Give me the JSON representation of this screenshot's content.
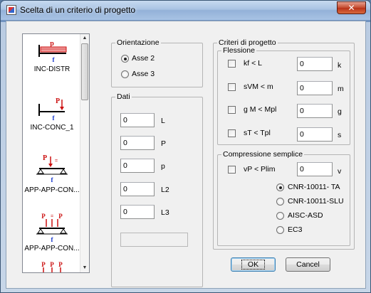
{
  "window": {
    "title": "Scelta di un criterio di progetto",
    "close_glyph": "✕"
  },
  "schemes": [
    {
      "label": "INC-DISTR",
      "icon": "cantilever-distributed-load-icon"
    },
    {
      "label": "INC-CONC_1",
      "icon": "cantilever-concentrated-load-icon"
    },
    {
      "label": "APP-APP-CON...",
      "icon": "simply-supported-concentrated-load-icon"
    },
    {
      "label": "APP-APP-CON...",
      "icon": "simply-supported-multiple-loads-icon"
    },
    {
      "label": "",
      "icon": "simply-supported-three-loads-icon"
    }
  ],
  "scheme_glyphs": {
    "p_upper": "P",
    "p_lower": "p",
    "f": "f",
    "eq": "="
  },
  "orientazione": {
    "label": "Orientazione",
    "options": [
      {
        "label": "Asse 2",
        "checked": true
      },
      {
        "label": "Asse 3",
        "checked": false
      }
    ]
  },
  "dati": {
    "label": "Dati",
    "fields": [
      {
        "value": "0",
        "unit": "L"
      },
      {
        "value": "0",
        "unit": "P"
      },
      {
        "value": "0",
        "unit": "p"
      },
      {
        "value": "0",
        "unit": "L2"
      },
      {
        "value": "0",
        "unit": "L3"
      }
    ],
    "result": ""
  },
  "criteri": {
    "label": "Criteri di progetto",
    "flessione": {
      "label": "Flessione",
      "rows": [
        {
          "label": "kf < L",
          "value": "0",
          "unit": "k"
        },
        {
          "label": "sVM < m",
          "value": "0",
          "unit": "m"
        },
        {
          "label": "g M < Mpl",
          "value": "0",
          "unit": "g"
        },
        {
          "label": "sT < Tpl",
          "value": "0",
          "unit": "s"
        }
      ]
    },
    "compressione": {
      "label": "Compressione semplice",
      "row": {
        "label": "vP < Plim",
        "value": "0",
        "unit": "v"
      },
      "options": [
        {
          "label": "CNR-10011- TA",
          "checked": true
        },
        {
          "label": "CNR-10011-SLU",
          "checked": false
        },
        {
          "label": "AISC-ASD",
          "checked": false
        },
        {
          "label": "EC3",
          "checked": false
        }
      ]
    }
  },
  "buttons": {
    "ok": "OK",
    "cancel": "Cancel"
  },
  "colors": {
    "load": "#cc1111",
    "support": "#1133cc",
    "beam": "#000000"
  }
}
